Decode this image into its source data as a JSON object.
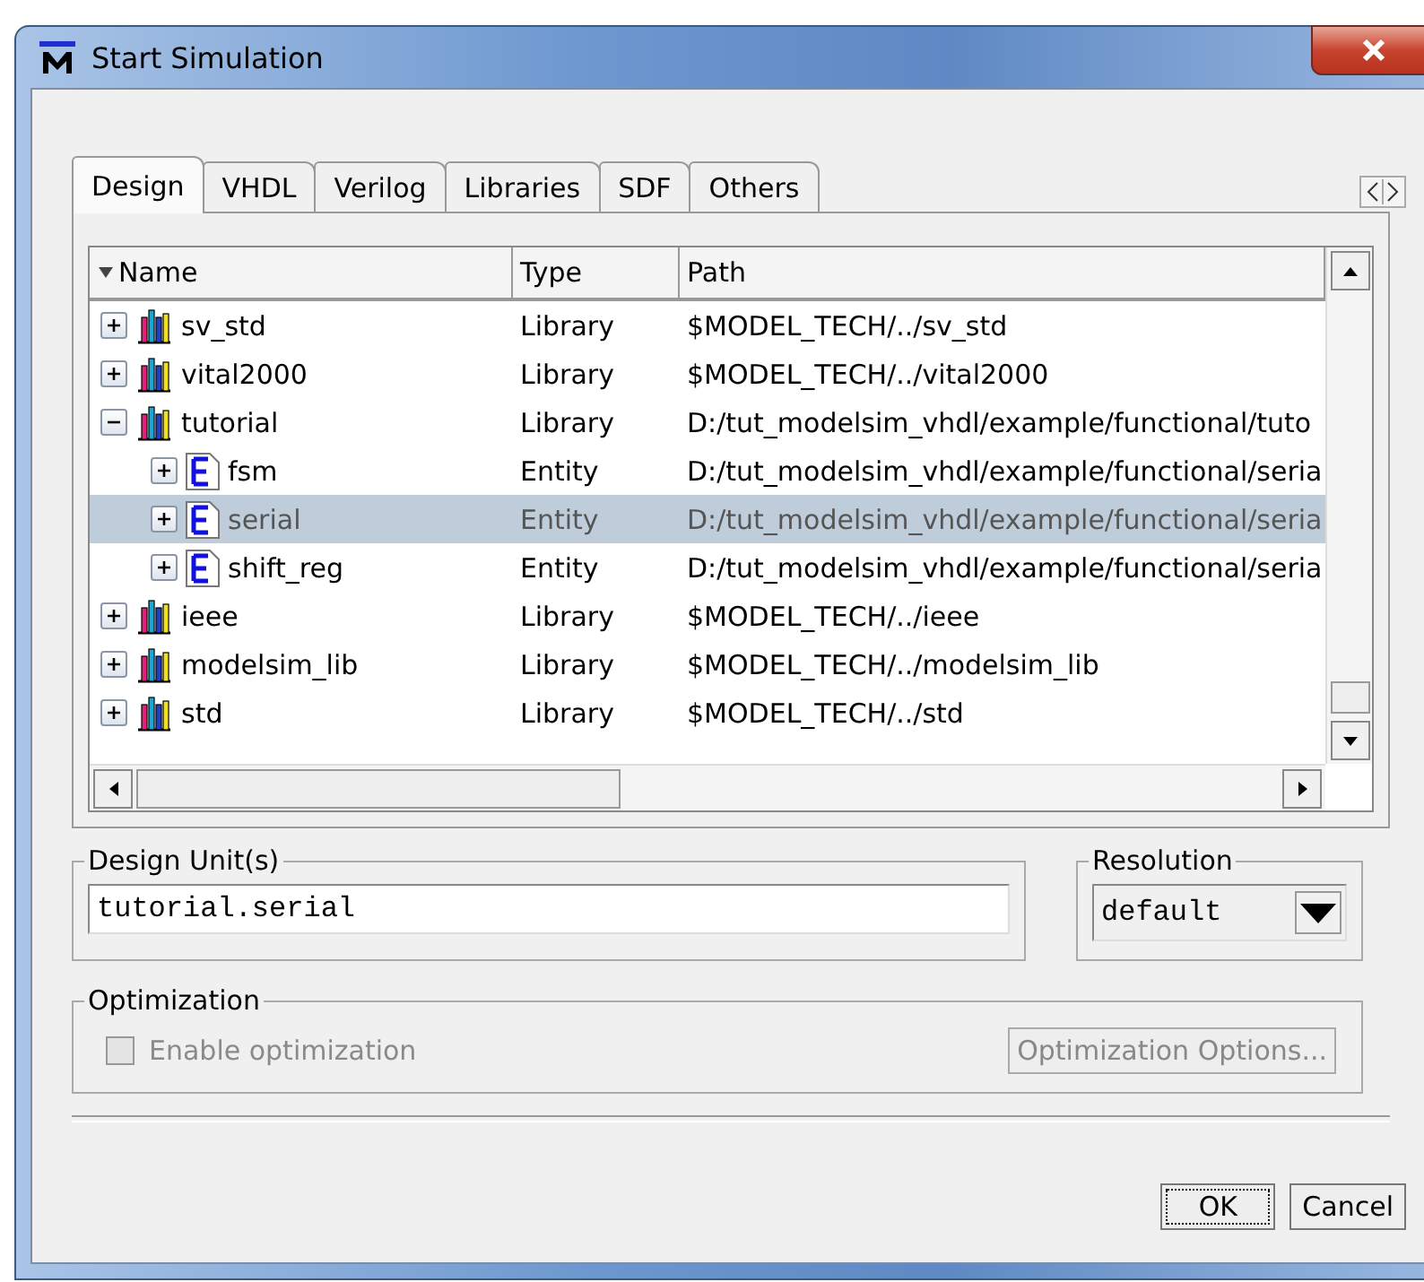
{
  "window": {
    "title": "Start Simulation"
  },
  "tabs": [
    {
      "label": "Design",
      "selected": true
    },
    {
      "label": "VHDL",
      "selected": false
    },
    {
      "label": "Verilog",
      "selected": false
    },
    {
      "label": "Libraries",
      "selected": false
    },
    {
      "label": "SDF",
      "selected": false
    },
    {
      "label": "Others",
      "selected": false
    }
  ],
  "tree": {
    "columns": [
      "Name",
      "Type",
      "Path"
    ],
    "items": [
      {
        "kind": "library",
        "name": "sv_std",
        "type": "Library",
        "path": "$MODEL_TECH/../sv_std",
        "expanded": false,
        "selected": false
      },
      {
        "kind": "library",
        "name": "vital2000",
        "type": "Library",
        "path": "$MODEL_TECH/../vital2000",
        "expanded": false,
        "selected": false
      },
      {
        "kind": "library",
        "name": "tutorial",
        "type": "Library",
        "path": "D:/tut_modelsim_vhdl/example/functional/tuto",
        "expanded": true,
        "selected": false,
        "children": [
          {
            "kind": "entity",
            "name": "fsm",
            "type": "Entity",
            "path": "D:/tut_modelsim_vhdl/example/functional/seria",
            "expanded": false,
            "selected": false
          },
          {
            "kind": "entity",
            "name": "serial",
            "type": "Entity",
            "path": "D:/tut_modelsim_vhdl/example/functional/seria",
            "expanded": false,
            "selected": true
          },
          {
            "kind": "entity",
            "name": "shift_reg",
            "type": "Entity",
            "path": "D:/tut_modelsim_vhdl/example/functional/seria",
            "expanded": false,
            "selected": false
          }
        ]
      },
      {
        "kind": "library",
        "name": "ieee",
        "type": "Library",
        "path": "$MODEL_TECH/../ieee",
        "expanded": false,
        "selected": false
      },
      {
        "kind": "library",
        "name": "modelsim_lib",
        "type": "Library",
        "path": "$MODEL_TECH/../modelsim_lib",
        "expanded": false,
        "selected": false
      },
      {
        "kind": "library",
        "name": "std",
        "type": "Library",
        "path": "$MODEL_TECH/../std",
        "expanded": false,
        "selected": false
      }
    ]
  },
  "design_unit": {
    "label": "Design Unit(s)",
    "value": "tutorial.serial"
  },
  "resolution": {
    "label": "Resolution",
    "value": "default"
  },
  "optimization": {
    "label": "Optimization",
    "checkbox": {
      "label": "Enable optimization",
      "checked": false,
      "disabled": true
    },
    "options_button": {
      "label": "Optimization Options...",
      "disabled": true
    }
  },
  "buttons": [
    {
      "label": "OK",
      "focused": true
    },
    {
      "label": "Cancel",
      "focused": false
    }
  ]
}
